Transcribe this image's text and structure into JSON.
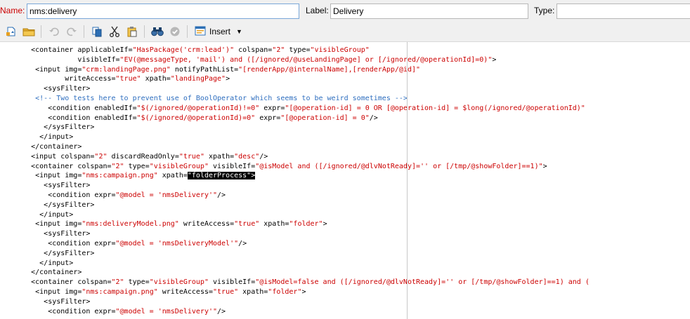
{
  "fields": {
    "name_label": "Name:",
    "name_value": "nms:delivery",
    "label_label": "Label:",
    "label_value": "Delivery",
    "type_label": "Type:",
    "type_value": ""
  },
  "toolbar": {
    "insert_label": "Insert"
  },
  "icons": {
    "new_doc": "new-document-icon",
    "open": "folder-icon",
    "undo": "undo-icon",
    "redo": "redo-icon",
    "copy": "copy-icon",
    "cut": "cut-icon",
    "paste": "paste-icon",
    "find": "binoculars-icon",
    "check": "check-circle-icon",
    "insert": "insert-icon"
  },
  "colors": {
    "tag": "#000000",
    "value": "#cc0000",
    "comment": "#2e6ebf",
    "name_label": "#cc0000",
    "selection": "#000000"
  },
  "code": [
    {
      "indent": 6,
      "segments": [
        {
          "k": "t",
          "s": "<container applicableIf="
        },
        {
          "k": "v",
          "s": "\"HasPackage('crm:lead')\""
        },
        {
          "k": "t",
          "s": " colspan="
        },
        {
          "k": "v",
          "s": "\"2\""
        },
        {
          "k": "t",
          "s": " type="
        },
        {
          "k": "v",
          "s": "\"visibleGroup\""
        }
      ]
    },
    {
      "indent": 17,
      "segments": [
        {
          "k": "t",
          "s": "visibleIf="
        },
        {
          "k": "v",
          "s": "\"EV(@messageType, 'mail') and ([/ignored/@useLandingPage] or [/ignored/@operationId]=0)\""
        },
        {
          "k": "t",
          "s": ">"
        }
      ]
    },
    {
      "indent": 7,
      "segments": [
        {
          "k": "t",
          "s": "<input img="
        },
        {
          "k": "v",
          "s": "\"crm:landingPage.png\""
        },
        {
          "k": "t",
          "s": " notifyPathList="
        },
        {
          "k": "v",
          "s": "\"[renderApp/@internalName],[renderApp/@id]\""
        }
      ]
    },
    {
      "indent": 14,
      "segments": [
        {
          "k": "t",
          "s": "writeAccess="
        },
        {
          "k": "v",
          "s": "\"true\""
        },
        {
          "k": "t",
          "s": " xpath="
        },
        {
          "k": "v",
          "s": "\"landingPage\""
        },
        {
          "k": "t",
          "s": ">"
        }
      ]
    },
    {
      "indent": 9,
      "segments": [
        {
          "k": "t",
          "s": "<sysFilter>"
        }
      ]
    },
    {
      "indent": 7,
      "segments": [
        {
          "k": "c",
          "s": "<!-- Two tests here to prevent use of BoolOperator which seems to be weird sometimes -->"
        }
      ]
    },
    {
      "indent": 10,
      "segments": [
        {
          "k": "t",
          "s": "<condition enabledIf="
        },
        {
          "k": "v",
          "s": "\"$(/ignored/@operationId)!=0\""
        },
        {
          "k": "t",
          "s": " expr="
        },
        {
          "k": "v",
          "s": "\"[@operation-id] = 0 OR [@operation-id] = $long(/ignored/@operationId)\""
        }
      ]
    },
    {
      "indent": 10,
      "segments": [
        {
          "k": "t",
          "s": "<condition enabledIf="
        },
        {
          "k": "v",
          "s": "\"$(/ignored/@operationId)=0\""
        },
        {
          "k": "t",
          "s": " expr="
        },
        {
          "k": "v",
          "s": "\"[@operation-id] = 0\""
        },
        {
          "k": "t",
          "s": "/>"
        }
      ]
    },
    {
      "indent": 9,
      "segments": [
        {
          "k": "t",
          "s": "</sysFilter>"
        }
      ]
    },
    {
      "indent": 8,
      "segments": [
        {
          "k": "t",
          "s": "</input>"
        }
      ]
    },
    {
      "indent": 6,
      "segments": [
        {
          "k": "t",
          "s": "</container>"
        }
      ]
    },
    {
      "indent": 6,
      "segments": [
        {
          "k": "t",
          "s": "<input colspan="
        },
        {
          "k": "v",
          "s": "\"2\""
        },
        {
          "k": "t",
          "s": " discardReadOnly="
        },
        {
          "k": "v",
          "s": "\"true\""
        },
        {
          "k": "t",
          "s": " xpath="
        },
        {
          "k": "v",
          "s": "\"desc\""
        },
        {
          "k": "t",
          "s": "/>"
        }
      ]
    },
    {
      "indent": 6,
      "segments": [
        {
          "k": "t",
          "s": "<container colspan="
        },
        {
          "k": "v",
          "s": "\"2\""
        },
        {
          "k": "t",
          "s": " type="
        },
        {
          "k": "v",
          "s": "\"visibleGroup\""
        },
        {
          "k": "t",
          "s": " visibleIf="
        },
        {
          "k": "v",
          "s": "\"@isModel and ([/ignored/@dlvNotReady]='' or [/tmp/@showFolder]==1)\""
        },
        {
          "k": "t",
          "s": ">"
        }
      ]
    },
    {
      "indent": 7,
      "segments": [
        {
          "k": "t",
          "s": "<input img="
        },
        {
          "k": "v",
          "s": "\"nms:campaign.png\""
        },
        {
          "k": "t",
          "s": " xpath="
        },
        {
          "k": "sel",
          "s": "\"folderProcess\">"
        }
      ]
    },
    {
      "indent": 9,
      "segments": [
        {
          "k": "t",
          "s": "<sysFilter>"
        }
      ]
    },
    {
      "indent": 10,
      "segments": [
        {
          "k": "t",
          "s": "<condition expr="
        },
        {
          "k": "v",
          "s": "\"@model = 'nmsDelivery'\""
        },
        {
          "k": "t",
          "s": "/>"
        }
      ]
    },
    {
      "indent": 9,
      "segments": [
        {
          "k": "t",
          "s": "</sysFilter>"
        }
      ]
    },
    {
      "indent": 8,
      "segments": [
        {
          "k": "t",
          "s": "</input>"
        }
      ]
    },
    {
      "indent": 7,
      "segments": [
        {
          "k": "t",
          "s": "<input img="
        },
        {
          "k": "v",
          "s": "\"nms:deliveryModel.png\""
        },
        {
          "k": "t",
          "s": " writeAccess="
        },
        {
          "k": "v",
          "s": "\"true\""
        },
        {
          "k": "t",
          "s": " xpath="
        },
        {
          "k": "v",
          "s": "\"folder\""
        },
        {
          "k": "t",
          "s": ">"
        }
      ]
    },
    {
      "indent": 9,
      "segments": [
        {
          "k": "t",
          "s": "<sysFilter>"
        }
      ]
    },
    {
      "indent": 10,
      "segments": [
        {
          "k": "t",
          "s": "<condition expr="
        },
        {
          "k": "v",
          "s": "\"@model = 'nmsDeliveryModel'\""
        },
        {
          "k": "t",
          "s": "/>"
        }
      ]
    },
    {
      "indent": 9,
      "segments": [
        {
          "k": "t",
          "s": "</sysFilter>"
        }
      ]
    },
    {
      "indent": 8,
      "segments": [
        {
          "k": "t",
          "s": "</input>"
        }
      ]
    },
    {
      "indent": 6,
      "segments": [
        {
          "k": "t",
          "s": "</container>"
        }
      ]
    },
    {
      "indent": 6,
      "segments": [
        {
          "k": "t",
          "s": "<container colspan="
        },
        {
          "k": "v",
          "s": "\"2\""
        },
        {
          "k": "t",
          "s": " type="
        },
        {
          "k": "v",
          "s": "\"visibleGroup\""
        },
        {
          "k": "t",
          "s": " visibleIf="
        },
        {
          "k": "v",
          "s": "\"@isModel=false and ([/ignored/@dlvNotReady]='' or [/tmp/@showFolder]==1) and ("
        }
      ]
    },
    {
      "indent": 7,
      "segments": [
        {
          "k": "t",
          "s": "<input img="
        },
        {
          "k": "v",
          "s": "\"nms:campaign.png\""
        },
        {
          "k": "t",
          "s": " writeAccess="
        },
        {
          "k": "v",
          "s": "\"true\""
        },
        {
          "k": "t",
          "s": " xpath="
        },
        {
          "k": "v",
          "s": "\"folder\""
        },
        {
          "k": "t",
          "s": ">"
        }
      ]
    },
    {
      "indent": 9,
      "segments": [
        {
          "k": "t",
          "s": "<sysFilter>"
        }
      ]
    },
    {
      "indent": 10,
      "segments": [
        {
          "k": "t",
          "s": "<condition expr="
        },
        {
          "k": "v",
          "s": "\"@model = 'nmsDelivery'\""
        },
        {
          "k": "t",
          "s": "/>"
        }
      ]
    }
  ]
}
